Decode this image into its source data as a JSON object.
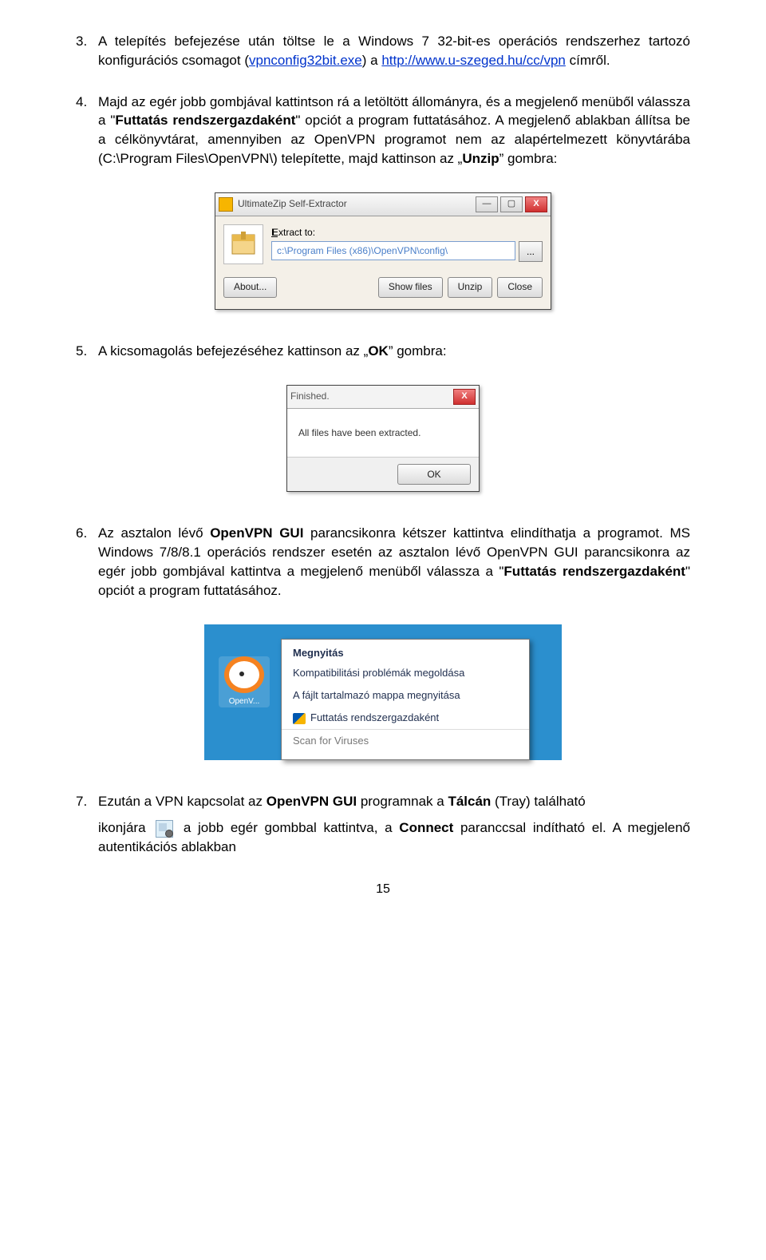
{
  "items": {
    "3": {
      "pre": "A telepítés befejezése után töltse le a Windows 7 32-bit-es operációs rendszerhez tartozó konfigurációs csomagot (",
      "link1_text": "vpnconfig32bit.exe",
      "mid": ") a ",
      "link2_text": "http://www.u-szeged.hu/cc/vpn",
      "post": " címről."
    },
    "4": {
      "text_a": "Majd az egér jobb gombjával kattintson rá a letöltött állományra, és a megjelenő menüből válassza a \"",
      "bold_a": "Futtatás rendszergazdaként",
      "text_b": "\" opciót a program futtatásához. A megjelenő ablakban állítsa be a célkönyvtárat, amennyiben az OpenVPN programot nem az alapértelmezett könyvtárába (C:\\Program Files\\OpenVPN\\) telepítette, majd kattinson az „",
      "bold_b": "Unzip",
      "text_c": "” gombra:"
    },
    "5": {
      "text_a": "A kicsomagolás befejezéséhez kattinson az „",
      "bold_a": "OK",
      "text_b": "” gombra:"
    },
    "6": {
      "text_a": "Az asztalon lévő ",
      "bold_a": "OpenVPN GUI",
      "text_b": " parancsikonra kétszer kattintva elindíthatja a programot. MS Windows 7/8/8.1 operációs rendszer esetén az asztalon lévő OpenVPN GUI parancsikonra az egér jobb gombjával kattintva a megjelenő menüből válassza a \"",
      "bold_b": "Futtatás rendszergazdaként",
      "text_c": "\" opciót a program futtatásához."
    },
    "7": {
      "text_a": "Ezután a VPN kapcsolat az ",
      "bold_a": "OpenVPN GUI",
      "text_b": " programnak a ",
      "bold_b": "Tálcán",
      "text_c": " (Tray) található",
      "line2_a": "ikonjára ",
      "line2_b": " a jobb egér gombbal kattintva, a ",
      "bold_c": "Connect",
      "line2_c": " paranccsal indítható el. A megjelenő autentikációs ablakban"
    }
  },
  "extractor": {
    "title": "UltimateZip Self-Extractor",
    "label": "Extract to:",
    "path": "c:\\Program Files (x86)\\OpenVPN\\config\\",
    "browse": "...",
    "about": "About...",
    "show": "Show files",
    "unzip": "Unzip",
    "close": "Close"
  },
  "finished": {
    "title": "Finished.",
    "msg": "All files have been extracted.",
    "ok": "OK"
  },
  "ctx": {
    "shortcut": "OpenV...",
    "head": "Megnyitás",
    "i1": "Kompatibilitási problémák megoldása",
    "i2": "A fájlt tartalmazó mappa megnyitása",
    "i3": "Futtatás rendszergazdaként",
    "i4": "Scan for Viruses"
  },
  "pagenum": "15"
}
